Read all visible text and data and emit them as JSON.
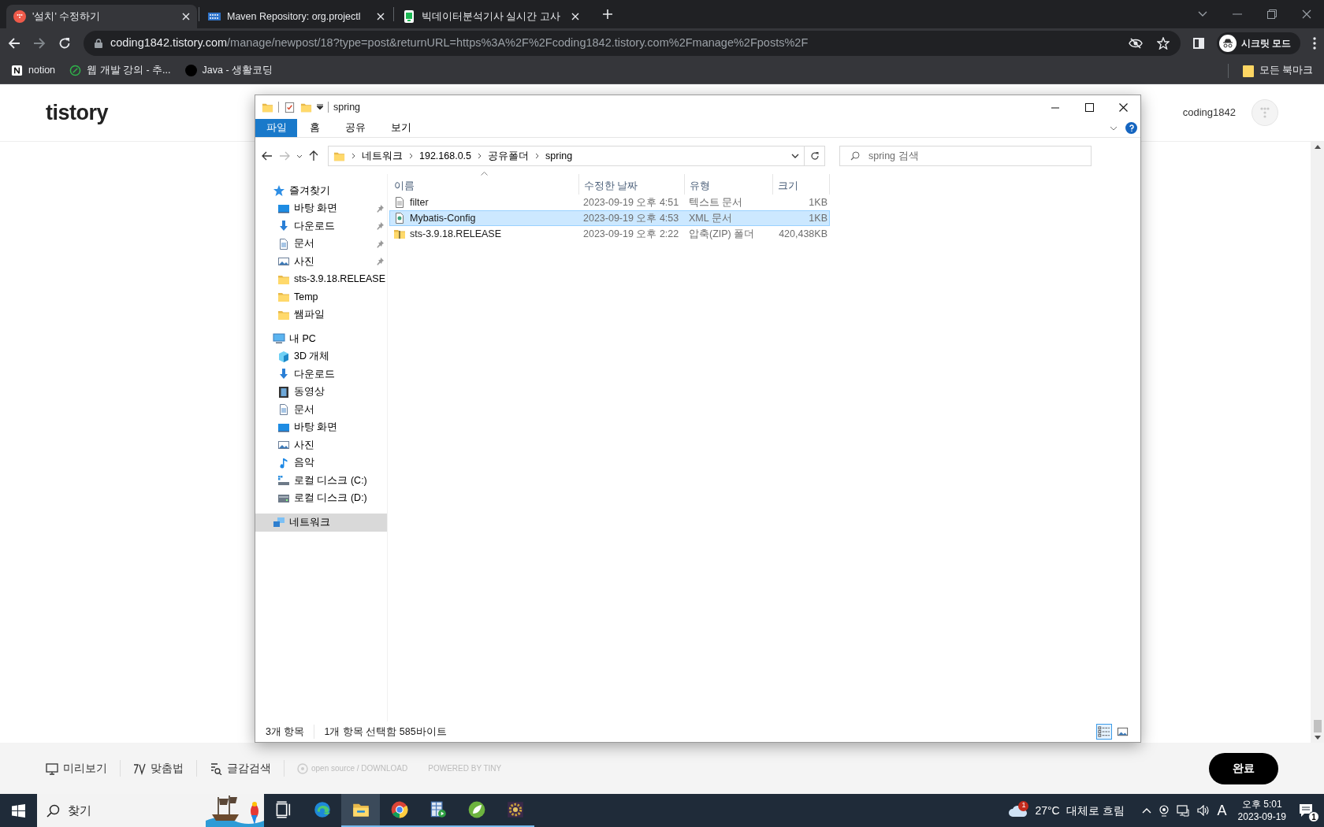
{
  "browser": {
    "tabs": [
      {
        "title": "'설치' 수정하기",
        "selected": true,
        "kind": "tistory"
      },
      {
        "title": "Maven Repository: org.projectl",
        "selected": false,
        "kind": "maven"
      },
      {
        "title": "빅데이터분석기사 실시간 고사",
        "selected": false,
        "kind": "phone"
      }
    ],
    "url": {
      "host": "coding1842.tistory.com",
      "path": "/manage/newpost/18?type=post&returnURL=https%3A%2F%2Fcoding1842.tistory.com%2Fmanage%2Fposts%2F"
    },
    "profile": "시크릿 모드",
    "bookmarks": [
      {
        "label": "notion",
        "kind": "notion"
      },
      {
        "label": "웹 개발 강의 - 추...",
        "kind": "leaf"
      },
      {
        "label": "Java - 생활코딩",
        "kind": "dot"
      }
    ],
    "all_bookmarks": "모든 북마크"
  },
  "blog": {
    "logo": "tistory",
    "username": "coding1842",
    "editor_tools": [
      {
        "label": "미리보기",
        "kind": "preview"
      },
      {
        "label": "맞춤법",
        "kind": "spell"
      },
      {
        "label": "글감검색",
        "kind": "search"
      }
    ],
    "credit": "open source / DOWNLOAD",
    "powered": "POWERED BY TINY",
    "done_button": "완료"
  },
  "explorer": {
    "title": "spring",
    "file_menu": "파일",
    "ribbon_tabs": [
      "홈",
      "공유",
      "보기"
    ],
    "breadcrumb": [
      "네트워크",
      "192.168.0.5",
      "공유폴더",
      "spring"
    ],
    "search": {
      "placeholder": "spring 검색"
    },
    "nav": [
      {
        "label": "즐겨찾기",
        "kind": "star",
        "selected": false,
        "children": [
          {
            "label": "바탕 화면",
            "kind": "desktop",
            "pinned": true,
            "selected": false
          },
          {
            "label": "다운로드",
            "kind": "download",
            "pinned": true,
            "selected": false
          },
          {
            "label": "문서",
            "kind": "document",
            "pinned": true,
            "selected": false
          },
          {
            "label": "사진",
            "kind": "picture",
            "pinned": true,
            "selected": false
          },
          {
            "label": "sts-3.9.18.RELEASE",
            "kind": "folder",
            "pinned": false,
            "selected": false
          },
          {
            "label": "Temp",
            "kind": "folder",
            "pinned": false,
            "selected": false
          },
          {
            "label": "쌤파일",
            "kind": "folder",
            "pinned": false,
            "selected": false
          }
        ]
      },
      {
        "label": "내 PC",
        "kind": "pc",
        "selected": false,
        "children": [
          {
            "label": "3D 개체",
            "kind": "cube",
            "pinned": false,
            "selected": false
          },
          {
            "label": "다운로드",
            "kind": "download",
            "pinned": false,
            "selected": false
          },
          {
            "label": "동영상",
            "kind": "video",
            "pinned": false,
            "selected": false
          },
          {
            "label": "문서",
            "kind": "document",
            "pinned": false,
            "selected": false
          },
          {
            "label": "바탕 화면",
            "kind": "desktop",
            "pinned": false,
            "selected": false
          },
          {
            "label": "사진",
            "kind": "picture",
            "pinned": false,
            "selected": false
          },
          {
            "label": "음악",
            "kind": "music",
            "pinned": false,
            "selected": false
          },
          {
            "label": "로컬 디스크 (C:)",
            "kind": "drive_system",
            "pinned": false,
            "selected": false
          },
          {
            "label": "로컬 디스크 (D:)",
            "kind": "drive",
            "pinned": false,
            "selected": false
          }
        ]
      },
      {
        "label": "네트워크",
        "kind": "network",
        "selected": true
      }
    ],
    "columns": [
      {
        "label": "이름",
        "sorted": true
      },
      {
        "label": "수정한 날짜",
        "sorted": false
      },
      {
        "label": "유형",
        "sorted": false
      },
      {
        "label": "크기",
        "sorted": false
      }
    ],
    "files": [
      {
        "name": "filter",
        "modified": "2023-09-19 오후 4:51",
        "type": "텍스트 문서",
        "size": "1KB",
        "kind": "text",
        "selected": false
      },
      {
        "name": "Mybatis-Config",
        "modified": "2023-09-19 오후 4:53",
        "type": "XML 문서",
        "size": "1KB",
        "kind": "xml",
        "selected": true
      },
      {
        "name": "sts-3.9.18.RELEASE",
        "modified": "2023-09-19 오후 2:22",
        "type": "압축(ZIP) 폴더",
        "size": "420,438KB",
        "kind": "zip",
        "selected": false
      }
    ],
    "status": {
      "count": "3개 항목",
      "selection": "1개 항목 선택함 585바이트"
    },
    "view_modes": [
      {
        "kind": "details",
        "selected": true
      },
      {
        "kind": "large_icons",
        "selected": false
      }
    ]
  },
  "taskbar": {
    "search": {
      "placeholder": "찾기"
    },
    "apps": [
      {
        "kind": "taskview",
        "active": false
      },
      {
        "kind": "edge",
        "active": false
      },
      {
        "kind": "explorer",
        "active": true
      },
      {
        "kind": "chrome",
        "active": false
      },
      {
        "kind": "app",
        "active": false
      },
      {
        "kind": "spring",
        "active": false
      },
      {
        "kind": "javaee",
        "active": false
      }
    ],
    "weather": {
      "badge": "1",
      "temperature": "27°C",
      "condition": "대체로 흐림"
    },
    "ime": "A",
    "time": "오후 5:01",
    "date": "2023-09-19",
    "notifications": "1"
  }
}
